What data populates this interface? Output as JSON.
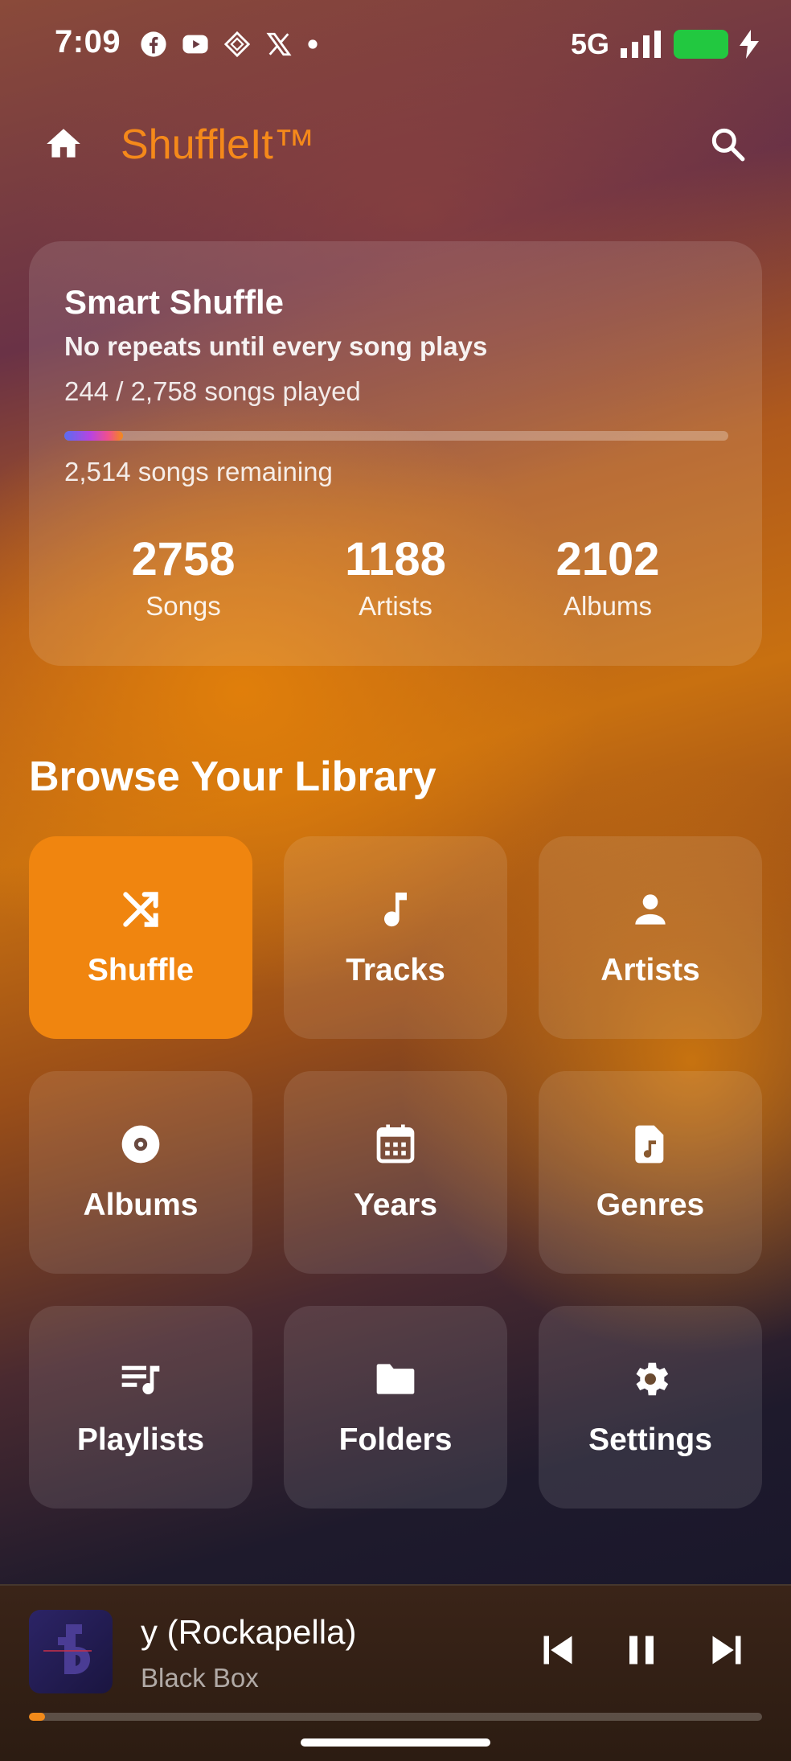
{
  "status_bar": {
    "time": "7:09",
    "network": "5G",
    "notification_icons": [
      "facebook-icon",
      "youtube-icon",
      "app-diamond-icon",
      "x-icon",
      "dot-icon"
    ],
    "battery_color": "#22c840"
  },
  "app_bar": {
    "title": "ShuffleIt™",
    "title_color": "#f5891a"
  },
  "smart_shuffle": {
    "title": "Smart Shuffle",
    "subtitle": "No repeats until every song plays",
    "played_text": "244 / 2,758 songs played",
    "progress_fraction": 0.0885,
    "remaining_text": "2,514 songs remaining",
    "stats": [
      {
        "value": "2758",
        "label": "Songs"
      },
      {
        "value": "1188",
        "label": "Artists"
      },
      {
        "value": "2102",
        "label": "Albums"
      }
    ]
  },
  "library": {
    "title": "Browse Your Library",
    "tiles": [
      {
        "label": "Shuffle",
        "icon": "shuffle-icon",
        "active": true
      },
      {
        "label": "Tracks",
        "icon": "music-note-icon",
        "active": false
      },
      {
        "label": "Artists",
        "icon": "person-icon",
        "active": false
      },
      {
        "label": "Albums",
        "icon": "disc-icon",
        "active": false
      },
      {
        "label": "Years",
        "icon": "calendar-icon",
        "active": false
      },
      {
        "label": "Genres",
        "icon": "music-file-icon",
        "active": false
      },
      {
        "label": "Playlists",
        "icon": "playlist-icon",
        "active": false
      },
      {
        "label": "Folders",
        "icon": "folder-icon",
        "active": false
      },
      {
        "label": "Settings",
        "icon": "gear-icon",
        "active": false
      }
    ],
    "accent_color": "#f0850f"
  },
  "now_playing": {
    "title": "y (Rockapella)",
    "artist": "Black Box",
    "progress_fraction": 0.022
  }
}
